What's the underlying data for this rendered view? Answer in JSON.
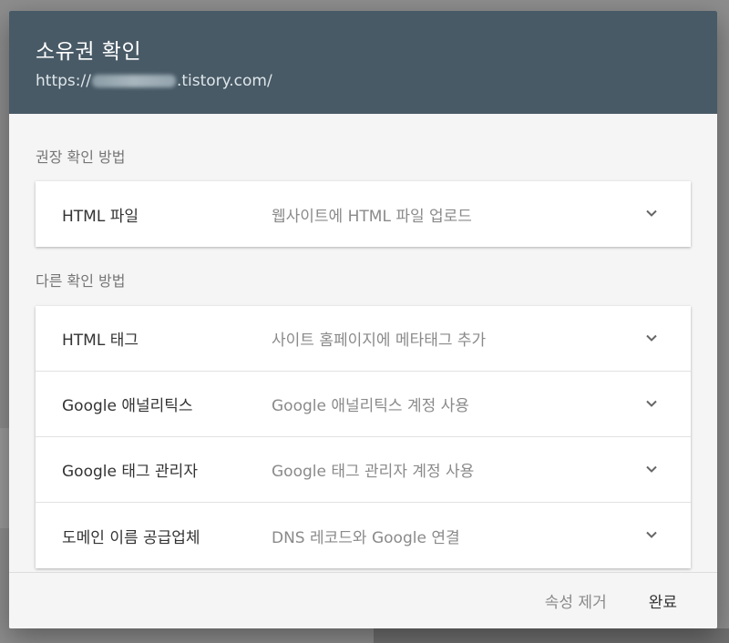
{
  "dialog": {
    "title": "소유권 확인",
    "url_prefix": "https://",
    "url_suffix": ".tistory.com/"
  },
  "recommended": {
    "label": "권장 확인 방법",
    "methods": [
      {
        "title": "HTML 파일",
        "desc": "웹사이트에 HTML 파일 업로드",
        "icon": "chevron-down-icon"
      }
    ]
  },
  "other": {
    "label": "다른 확인 방법",
    "methods": [
      {
        "title": "HTML 태그",
        "desc": "사이트 홈페이지에 메타태그 추가",
        "icon": "chevron-down-icon"
      },
      {
        "title": "Google 애널리틱스",
        "desc": "Google 애널리틱스 계정 사용",
        "icon": "chevron-down-icon"
      },
      {
        "title": "Google 태그 관리자",
        "desc": "Google 태그 관리자 계정 사용",
        "icon": "chevron-down-icon"
      },
      {
        "title": "도메인 이름 공급업체",
        "desc": "DNS 레코드와 Google 연결",
        "icon": "chevron-down-icon"
      }
    ]
  },
  "footer": {
    "remove_label": "속성 제거",
    "done_label": "완료"
  },
  "colors": {
    "header_bg": "#485a66",
    "dialog_bg": "#f5f5f5",
    "card_bg": "#ffffff"
  }
}
